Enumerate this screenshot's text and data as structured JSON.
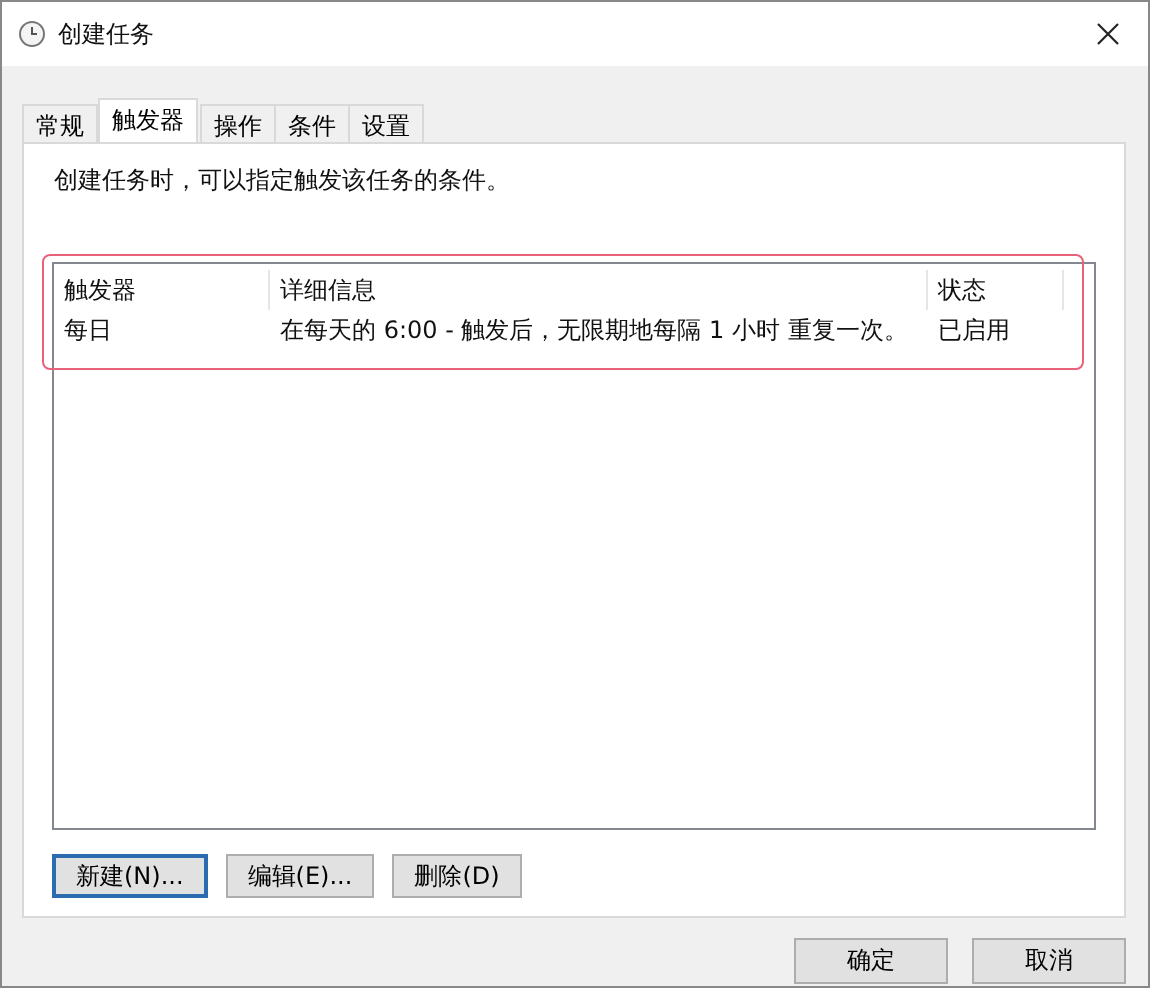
{
  "window": {
    "title": "创建任务"
  },
  "tabs": [
    {
      "label": "常规",
      "selected": false
    },
    {
      "label": "触发器",
      "selected": true
    },
    {
      "label": "操作",
      "selected": false
    },
    {
      "label": "条件",
      "selected": false
    },
    {
      "label": "设置",
      "selected": false
    }
  ],
  "description": "创建任务时，可以指定触发该任务的条件。",
  "table": {
    "columns": [
      "触发器",
      "详细信息",
      "状态"
    ],
    "rows": [
      {
        "cells": [
          "每日",
          "在每天的 6:00 - 触发后，无限期地每隔 1 小时 重复一次。",
          "已启用"
        ],
        "selected": false
      }
    ],
    "highlighted": true
  },
  "list_buttons": [
    {
      "label": "新建(N)...",
      "focused": true
    },
    {
      "label": "编辑(E)...",
      "focused": false
    },
    {
      "label": "删除(D)",
      "focused": false
    }
  ],
  "dialog_buttons": [
    "确定",
    "取消"
  ]
}
